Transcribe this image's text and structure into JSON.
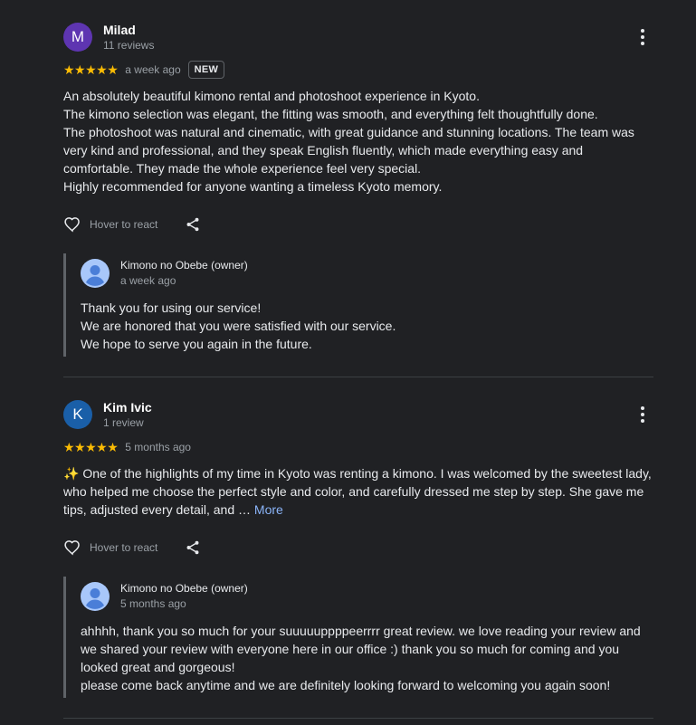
{
  "reviews": [
    {
      "author": "Milad",
      "initial": "M",
      "avatar_color": "#5e35b1",
      "review_count": "11 reviews",
      "stars": "★★★★★",
      "rating": 5,
      "time": "a week ago",
      "badge": "NEW",
      "text_lines": [
        "An absolutely beautiful kimono rental and photoshoot experience in Kyoto.",
        "The kimono selection was elegant, the fitting was smooth, and everything felt thoughtfully done.",
        "The photoshoot was natural and cinematic, with great guidance and stunning locations. The team was very kind and professional, and they speak English fluently, which made everything easy and comfortable. They made the whole experience feel very special.",
        "Highly recommended for anyone wanting a timeless Kyoto memory."
      ],
      "react_label": "Hover to react",
      "reply": {
        "owner": "Kimono no Obebe (owner)",
        "time": "a week ago",
        "lines": [
          "Thank you for using our service!",
          "We are honored that you were satisfied with our service.",
          "We hope to serve you again in the future."
        ]
      }
    },
    {
      "author": "Kim Ivic",
      "initial": "K",
      "avatar_color": "#1a5fa8",
      "review_count": "1 review",
      "stars": "★★★★★",
      "rating": 5,
      "time": "5 months ago",
      "text": "✨ One of the highlights of my time in Kyoto was renting a kimono. I was welcomed by the sweetest lady, who helped me choose the perfect style and color, and carefully dressed me step by step. She gave me tips, adjusted every detail, and … ",
      "more_label": "More",
      "react_label": "Hover to react",
      "reply": {
        "owner": "Kimono no Obebe (owner)",
        "time": "5 months ago",
        "lines": [
          "ahhhh, thank you so much for your suuuuuppppeerrrr great review. we love reading your review and we shared your review with everyone here in our office :) thank you so much for coming and you looked great and gorgeous!",
          "please come back anytime and we are definitely looking forward to welcoming you again soon!"
        ]
      }
    }
  ]
}
